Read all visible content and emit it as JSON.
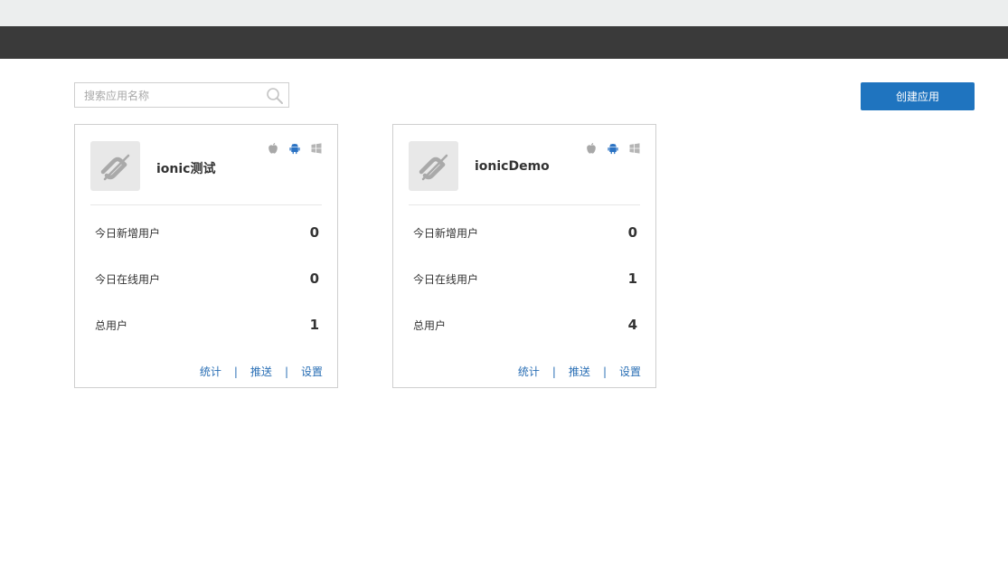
{
  "search": {
    "placeholder": "搜索应用名称",
    "value": ""
  },
  "header": {
    "create_button_label": "创建应用",
    "accent_color": "#1f74bf"
  },
  "apps": [
    {
      "name": "ionic测试",
      "platforms": [
        "apple-icon",
        "android-icon",
        "windows-icon"
      ],
      "stats": [
        {
          "label": "今日新增用户",
          "value": "0"
        },
        {
          "label": "今日在线用户",
          "value": "0"
        },
        {
          "label": "总用户",
          "value": "1"
        }
      ],
      "actions": {
        "stats": "统计",
        "push": "推送",
        "settings": "设置",
        "separator": "|"
      }
    },
    {
      "name": "ionicDemo",
      "platforms": [
        "apple-icon",
        "android-icon",
        "windows-icon"
      ],
      "stats": [
        {
          "label": "今日新增用户",
          "value": "0"
        },
        {
          "label": "今日在线用户",
          "value": "1"
        },
        {
          "label": "总用户",
          "value": "4"
        }
      ],
      "actions": {
        "stats": "统计",
        "push": "推送",
        "settings": "设置",
        "separator": "|"
      }
    }
  ]
}
